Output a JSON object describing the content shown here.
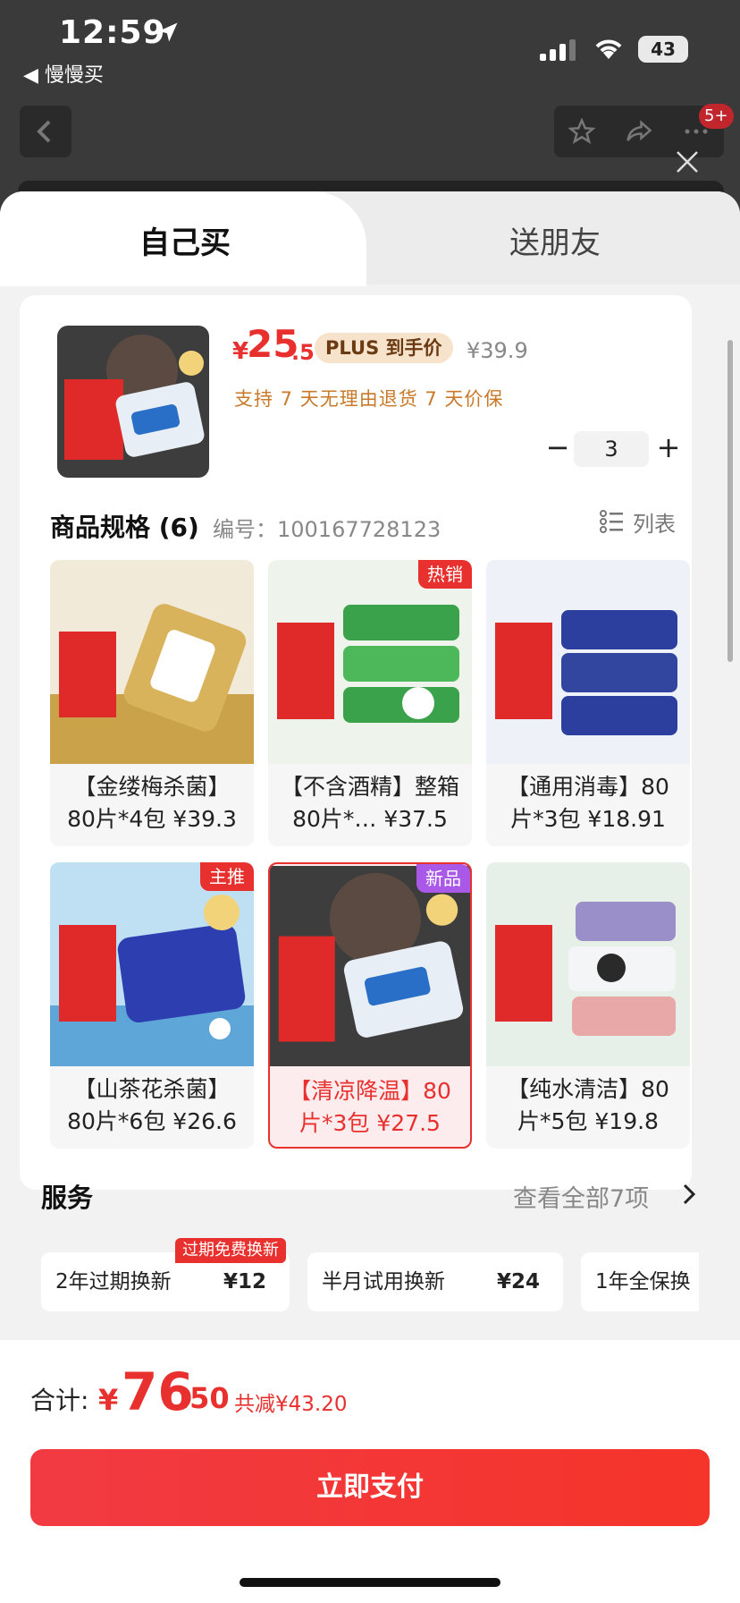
{
  "status_bar": {
    "time": "12:59",
    "back_app": "◀ 慢慢买",
    "battery": "43"
  },
  "header": {
    "cart_badge": "5+"
  },
  "tabs": [
    {
      "label": "自己买"
    },
    {
      "label": "送朋友"
    }
  ],
  "product": {
    "price_currency": "¥",
    "price_int": "25",
    "price_dec": ".5",
    "plus_label": "PLUS 到手价",
    "original_price": "¥39.9",
    "policy": "支持 7 天无理由退货   7 天价保",
    "quantity": "3",
    "qty_minus": "−",
    "qty_plus": "+"
  },
  "specs": {
    "title": "商品规格 (6)",
    "code": "编号：100167728123",
    "list_label": "列表",
    "items": [
      {
        "text": "【金缕梅杀菌】80片*4包 ¥39.3",
        "badge": "",
        "color": "#d9b25c"
      },
      {
        "text": "【不含酒精】整箱80片*… ¥37.5",
        "badge": "热销",
        "color": "#3aa24a"
      },
      {
        "text": "【通用消毒】80片*3包 ¥18.91",
        "badge": "",
        "color": "#2c3f9e"
      },
      {
        "text": "【山茶花杀菌】80片*6包 ¥26.6",
        "badge": "主推",
        "color": "#2d3fb0"
      },
      {
        "text": "【清凉降温】80片*3包 ¥27.5",
        "badge": "新品",
        "color": "#2a4a7a"
      },
      {
        "text": "【纯水清洁】80片*5包 ¥19.8",
        "badge": "",
        "color": "#9aa7c8"
      }
    ]
  },
  "services": {
    "title": "服务",
    "view_all": "查看全部7项",
    "hot_tag": "过期免费换新",
    "items": [
      {
        "name": "2年过期换新",
        "price": "¥12"
      },
      {
        "name": "半月试用换新",
        "price": "¥24"
      },
      {
        "name": "1年全保换",
        "price": ""
      }
    ]
  },
  "footer": {
    "total_label": "合计:",
    "total_currency": "¥",
    "total_int": "76",
    "total_dec": ".50",
    "savings": "共减¥43.20",
    "pay_label": "立即支付"
  },
  "colors": {
    "accent": "#e8302e",
    "plus_bg": "#f7e3cc",
    "policy": "#c87a2a"
  }
}
